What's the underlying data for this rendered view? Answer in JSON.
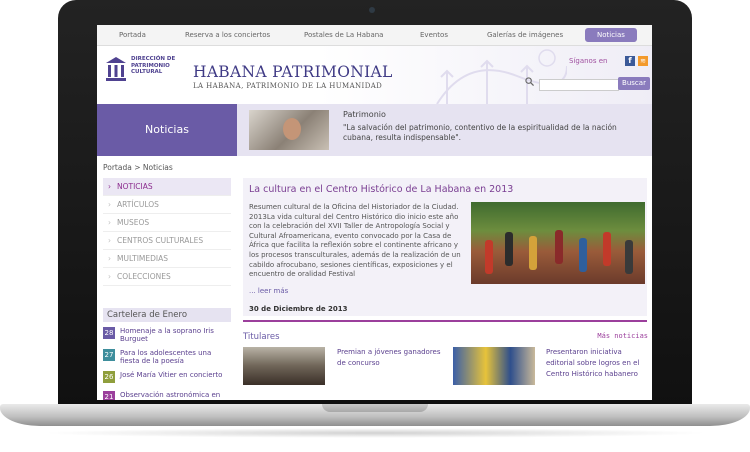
{
  "topnav": [
    "Portada",
    "Reserva a los conciertos",
    "Postales de La Habana",
    "Eventos",
    "Galerías de imágenes",
    "Noticias"
  ],
  "logo": {
    "line1": "DIRECCIÓN DE",
    "line2": "PATRIMONIO",
    "line3": "CULTURAL"
  },
  "site": {
    "title": "HABANA PATRIMONIAL",
    "subtitle": "LA HABANA, PATRIMONIO DE LA HUMANIDAD"
  },
  "social": {
    "follow": "Síganos en",
    "fb": "f",
    "rss": "≋"
  },
  "search": {
    "button": "Buscar",
    "value": ""
  },
  "banner": {
    "section": "Noticias",
    "category": "Patrimonio",
    "quote": "\"La salvación del patrimonio, contentivo de la espiritualidad de la nación cubana, resulta indispensable\"."
  },
  "breadcrumb": "Portada > Noticias",
  "sidenav": [
    "NOTICIAS",
    "ARTÍCULOS",
    "MUSEOS",
    "CENTROS CULTURALES",
    "MULTIMEDIAS",
    "COLECCIONES"
  ],
  "cartelera": {
    "title": "Cartelera de Enero",
    "events": [
      {
        "day": "28",
        "text": "Homenaje a la soprano Iris Burguet",
        "color": "#6a5ba6"
      },
      {
        "day": "27",
        "text": "Para los adolescentes una fiesta de la poesía",
        "color": "#3e8e9c"
      },
      {
        "day": "26",
        "text": "José María Vitier en concierto",
        "color": "#8f9e3c"
      },
      {
        "day": "21",
        "text": "Observación astronómica en",
        "color": "#9b3f9c"
      }
    ]
  },
  "featured": {
    "title": "La cultura en el Centro Histórico de La Habana en 2013",
    "body": "Resumen cultural de la Oficina del Historiador de la Ciudad. 2013La vida cultural del Centro Histórico dio inicio este año con la celebración del XVII Taller de Antropología Social y Cultural Afroamericana, evento convocado por la Casa de África que facilita la reflexión sobre el continente africano y los procesos transculturales, además de la realización de un cabildo afrocubano, sesiones científicas, exposiciones y el encuentro de oralidad Festival",
    "readmore": "... leer más",
    "date": "30 de Diciembre de 2013"
  },
  "titulares": {
    "title": "Titulares",
    "more": "Más noticias",
    "items": [
      "Premian a jóvenes ganadores de concurso",
      "Presentaron iniciativa editorial sobre logros en el Centro Histórico habanero"
    ]
  }
}
